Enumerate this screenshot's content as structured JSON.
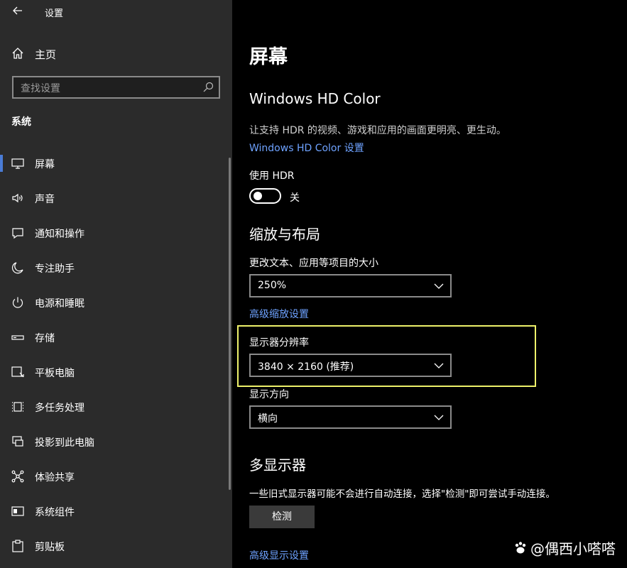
{
  "window": {
    "title": "设置"
  },
  "sidebar": {
    "home_label": "主页",
    "search_placeholder": "查找设置",
    "section_title": "系统",
    "items": [
      {
        "label": "屏幕",
        "icon": "monitor-icon",
        "selected": true
      },
      {
        "label": "声音",
        "icon": "speaker-icon"
      },
      {
        "label": "通知和操作",
        "icon": "notification-icon"
      },
      {
        "label": "专注助手",
        "icon": "moon-icon"
      },
      {
        "label": "电源和睡眠",
        "icon": "power-icon"
      },
      {
        "label": "存储",
        "icon": "storage-icon"
      },
      {
        "label": "平板电脑",
        "icon": "tablet-icon"
      },
      {
        "label": "多任务处理",
        "icon": "multitask-icon"
      },
      {
        "label": "投影到此电脑",
        "icon": "project-icon"
      },
      {
        "label": "体验共享",
        "icon": "share-icon"
      },
      {
        "label": "系统组件",
        "icon": "components-icon"
      },
      {
        "label": "剪贴板",
        "icon": "clipboard-icon"
      }
    ]
  },
  "main": {
    "page_title": "屏幕",
    "hdr": {
      "heading": "Windows HD Color",
      "description": "让支持 HDR 的视频、游戏和应用的画面更明亮、更生动。",
      "link": "Windows HD Color 设置",
      "toggle_label": "使用 HDR",
      "toggle_state": "关",
      "toggle_on": false
    },
    "scale": {
      "heading": "缩放与布局",
      "text_size_label": "更改文本、应用等项目的大小",
      "text_size_value": "250%",
      "advanced_link": "高级缩放设置",
      "resolution_label": "显示器分辨率",
      "resolution_value": "3840 × 2160 (推荐)",
      "orientation_label": "显示方向",
      "orientation_value": "横向"
    },
    "multi": {
      "heading": "多显示器",
      "description": "一些旧式显示器可能不会进行自动连接，选择\"检测\"即可尝试手动连接。",
      "detect_button": "检测",
      "advanced_link": "高级显示设置"
    }
  },
  "watermark": {
    "text": "@偶西小嗒嗒"
  },
  "colors": {
    "accent": "#4a7cd6",
    "link": "#6ea2ff",
    "highlight": "#eef16a",
    "sidebar_bg": "#2b2b2b"
  }
}
